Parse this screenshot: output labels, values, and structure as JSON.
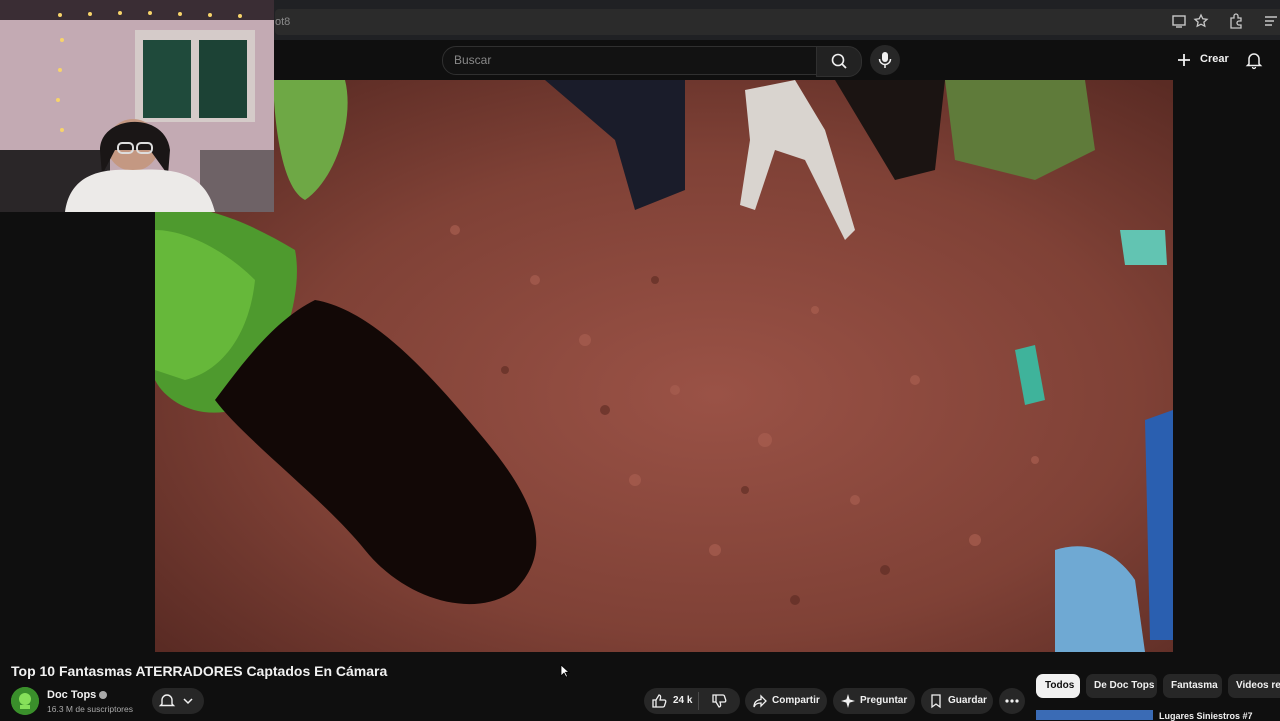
{
  "browser": {
    "url_fragment": "ot8",
    "icons": [
      "cast-icon",
      "star-icon",
      "extensions-icon",
      "menu-icon"
    ]
  },
  "header": {
    "search_placeholder": "Buscar",
    "create_label": "Crear",
    "icons": [
      "search-icon",
      "mic-icon",
      "plus-icon",
      "bell-icon"
    ]
  },
  "video": {
    "title": "Top 10 Fantasmas ATERRADORES Captados En Cámara",
    "channel": {
      "name": "Doc Tops",
      "subscribers": "16.3 M de suscriptores",
      "verified": true
    },
    "actions": {
      "likes": "24 k",
      "share": "Compartir",
      "ask": "Preguntar",
      "save": "Guardar"
    }
  },
  "chips": [
    "Todos",
    "De Doc Tops",
    "Fantasma",
    "Videos re"
  ],
  "related": {
    "first_title": "Lugares Siniestros #7"
  },
  "colors": {
    "background": "#0f0f0f",
    "accent_channel": "#3a8f2b",
    "active_chip_bg": "#f1f1f1"
  }
}
